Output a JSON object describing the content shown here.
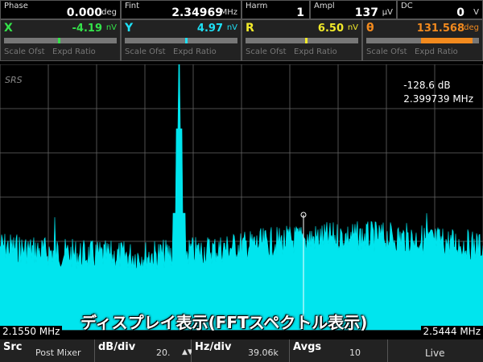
{
  "top_row": [
    {
      "label": "Phase",
      "value": "0.000",
      "unit": "deg"
    },
    {
      "label": "Fint",
      "value": "2.34969",
      "unit": "MHz"
    },
    {
      "label": "Harm",
      "value": "1",
      "unit": ""
    },
    {
      "label": "Ampl",
      "value": "137",
      "unit": "µV"
    },
    {
      "label": "DC",
      "value": "0",
      "unit": "V"
    }
  ],
  "channels": [
    {
      "label": "X",
      "value": "-4.19",
      "unit": "nV",
      "color": "#34e34a",
      "mark": 0.47,
      "scale": "Scale Ofst",
      "expd": "Expd Ratio"
    },
    {
      "label": "Y",
      "value": "4.97",
      "unit": "nV",
      "color": "#1ee0f5",
      "mark": 0.53,
      "scale": "Scale Ofst",
      "expd": "Expd Ratio"
    },
    {
      "label": "R",
      "value": "6.50",
      "unit": "nV",
      "color": "#f2ea2a",
      "mark": 0.52,
      "scale": "Scale Ofst",
      "expd": "Expd Ratio"
    },
    {
      "label": "θ",
      "value": "131.568",
      "unit": "deg",
      "color": "#f28a1e",
      "mark": 0.73,
      "scale": "Scale Ofst",
      "expd": "Expd Ratio"
    }
  ],
  "logo": "SRS",
  "cursor": {
    "db": "-128.6 dB",
    "freq": "2.399739 MHz"
  },
  "freq_start": "2.1550 MHz",
  "freq_end": "2.5444 MHz",
  "caption": "ディスプレイ表示(FFTスペクトル表示)",
  "footer": {
    "src_label": "Src",
    "src_value": "Post Mixer",
    "dbdiv_label": "dB/div",
    "dbdiv_value": "20.",
    "hzdiv_label": "Hz/div",
    "hzdiv_value": "39.06k",
    "avgs_label": "Avgs",
    "avgs_value": "10",
    "live": "Live"
  },
  "colors": {
    "spectrum": "#00e5ee",
    "grid": "#666666"
  }
}
